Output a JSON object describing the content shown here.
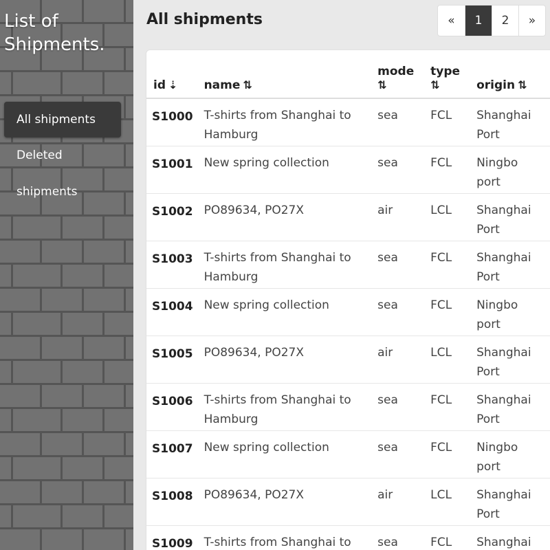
{
  "sidebar": {
    "title": "List of Shipments.",
    "nav": [
      {
        "label": "All shipments",
        "active": true
      },
      {
        "label": "Deleted",
        "active": false
      },
      {
        "label": "shipments",
        "active": false
      }
    ]
  },
  "main": {
    "title": "All shipments"
  },
  "pagination": {
    "prev": "«",
    "pages": [
      "1",
      "2"
    ],
    "current": "1",
    "next": "»"
  },
  "table": {
    "headers": {
      "id": "id",
      "id_sort_icon": "⇣",
      "name": "name",
      "name_sort_icon": "⇅",
      "mode": "mode",
      "mode_sort_icon": "⇅",
      "type": "type",
      "type_sort_icon": "⇅",
      "origin": "origin",
      "origin_sort_icon": "⇅"
    },
    "rows": [
      {
        "id": "S1000",
        "name": "T-shirts from Shanghai to Hamburg",
        "mode": "sea",
        "type": "FCL",
        "origin": "Shanghai Port"
      },
      {
        "id": "S1001",
        "name": "New spring collection",
        "mode": "sea",
        "type": "FCL",
        "origin": "Ningbo port"
      },
      {
        "id": "S1002",
        "name": "PO89634, PO27X",
        "mode": "air",
        "type": "LCL",
        "origin": "Shanghai Port"
      },
      {
        "id": "S1003",
        "name": "T-shirts from Shanghai to Hamburg",
        "mode": "sea",
        "type": "FCL",
        "origin": "Shanghai Port"
      },
      {
        "id": "S1004",
        "name": "New spring collection",
        "mode": "sea",
        "type": "FCL",
        "origin": "Ningbo port"
      },
      {
        "id": "S1005",
        "name": "PO89634, PO27X",
        "mode": "air",
        "type": "LCL",
        "origin": "Shanghai Port"
      },
      {
        "id": "S1006",
        "name": "T-shirts from Shanghai to Hamburg",
        "mode": "sea",
        "type": "FCL",
        "origin": "Shanghai Port"
      },
      {
        "id": "S1007",
        "name": "New spring collection",
        "mode": "sea",
        "type": "FCL",
        "origin": "Ningbo port"
      },
      {
        "id": "S1008",
        "name": "PO89634, PO27X",
        "mode": "air",
        "type": "LCL",
        "origin": "Shanghai Port"
      },
      {
        "id": "S1009",
        "name": "T-shirts from Shanghai to Hamburg",
        "mode": "sea",
        "type": "FCL",
        "origin": "Shanghai Port"
      }
    ]
  }
}
